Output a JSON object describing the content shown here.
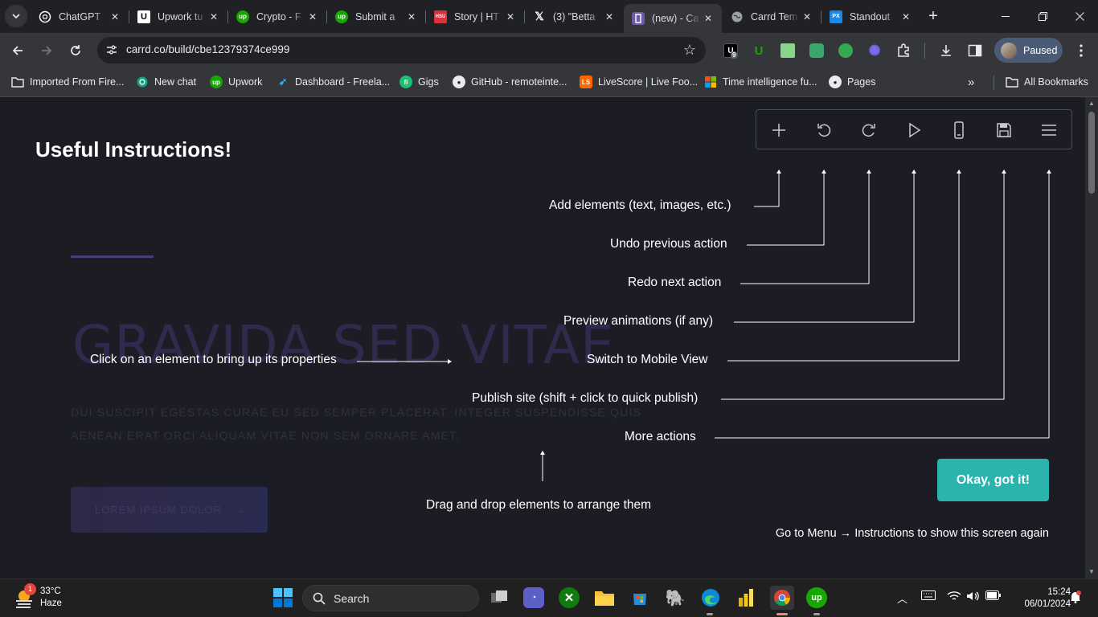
{
  "browser": {
    "tabs": [
      {
        "title": "ChatGPT",
        "icon": "chatgpt-icon"
      },
      {
        "title": "Upwork tu",
        "icon": "upwork-u-icon"
      },
      {
        "title": "Crypto - F",
        "icon": "upwork-icon"
      },
      {
        "title": "Submit a",
        "icon": "upwork-icon"
      },
      {
        "title": "Story | HT",
        "icon": "hsu-icon"
      },
      {
        "title": "(3) \"Betta",
        "icon": "x-icon"
      },
      {
        "title": "(new) - Ca",
        "icon": "carrd-icon",
        "active": true
      },
      {
        "title": "Carrd Tem",
        "icon": "globe-icon"
      },
      {
        "title": "Standout",
        "icon": "px-icon"
      }
    ],
    "url": "carrd.co/build/cbe12379374ce999",
    "extension_badge": "9",
    "profile_label": "Paused",
    "bookmarks": [
      {
        "label": "Imported From Fire...",
        "icon": "folder-icon"
      },
      {
        "label": "New chat",
        "icon": "chatgpt-icon"
      },
      {
        "label": "Upwork",
        "icon": "upwork-icon"
      },
      {
        "label": "Dashboard - Freela...",
        "icon": "freelancer-icon"
      },
      {
        "label": "Gigs",
        "icon": "fiverr-icon"
      },
      {
        "label": "GitHub - remoteinte...",
        "icon": "github-icon"
      },
      {
        "label": "LiveScore | Live Foo...",
        "icon": "livescore-icon"
      },
      {
        "label": "Time intelligence fu...",
        "icon": "microsoft-icon"
      },
      {
        "label": "Pages",
        "icon": "github-icon"
      }
    ],
    "all_bookmarks_label": "All Bookmarks"
  },
  "page": {
    "heading": "Useful Instructions!",
    "background": {
      "title": "GRAVIDA SED VITAE",
      "body": "DUI SUSCIPIT EGESTAS CURAE EU SED SEMPER PLACERAT. INTEGER SUSPENDISSE QUIS AENEAN ERAT ORCI ALIQUAM VITAE NON SEM ORNARE AMET.",
      "button": "LOREM IPSUM DOLOR"
    },
    "toolbar_icons": [
      "plus-icon",
      "undo-icon",
      "redo-icon",
      "play-icon",
      "mobile-icon",
      "save-icon",
      "menu-icon"
    ],
    "notes": {
      "add": "Add elements (text, images, etc.)",
      "undo": "Undo previous action",
      "redo": "Redo next action",
      "preview": "Preview animations (if any)",
      "mobile": "Switch to Mobile View",
      "publish": "Publish site (shift + click to quick publish)",
      "more": "More actions",
      "click": "Click on an element to bring up its properties",
      "drag": "Drag and drop elements to arrange them"
    },
    "ok_button": "Okay, got it!",
    "footer_hint": "Go to Menu → Instructions to show this screen again",
    "accent_color": "#2bb4ae"
  },
  "taskbar": {
    "weather_temp": "33°C",
    "weather_desc": "Haze",
    "weather_badge": "1",
    "search_label": "Search",
    "time": "15:24",
    "date": "06/01/2024"
  }
}
